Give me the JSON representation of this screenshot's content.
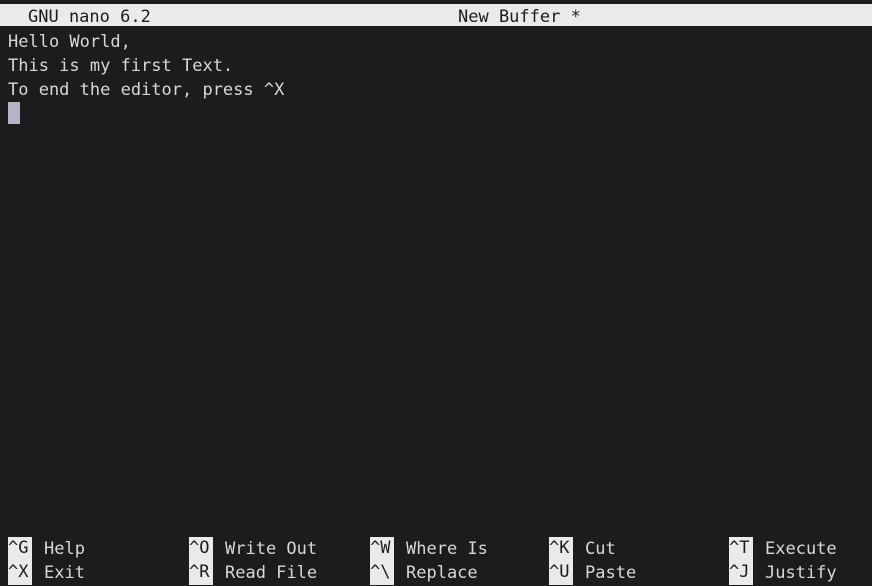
{
  "titlebar": {
    "app": "GNU nano 6.2",
    "buffer": "New Buffer *"
  },
  "editor": {
    "lines": [
      "Hello World,",
      "This is my first Text.",
      "To end the editor, press ^X"
    ],
    "cursor": {
      "row": 4,
      "col": 1
    }
  },
  "shortcuts": [
    {
      "key": "^G",
      "label": "Help",
      "key2": "^X",
      "label2": "Exit"
    },
    {
      "key": "^O",
      "label": "Write Out",
      "key2": "^R",
      "label2": "Read File"
    },
    {
      "key": "^W",
      "label": "Where Is",
      "key2": "^\\",
      "label2": "Replace"
    },
    {
      "key": "^K",
      "label": "Cut",
      "key2": "^U",
      "label2": "Paste"
    },
    {
      "key": "^T",
      "label": "Execute",
      "key2": "^J",
      "label2": "Justify"
    }
  ],
  "colors": {
    "background": "#1c1c1c",
    "foreground": "#d8d8d8",
    "inverse_bg": "#eaeaea",
    "inverse_fg": "#1c1c1c",
    "cursor": "#b3b5c4"
  }
}
